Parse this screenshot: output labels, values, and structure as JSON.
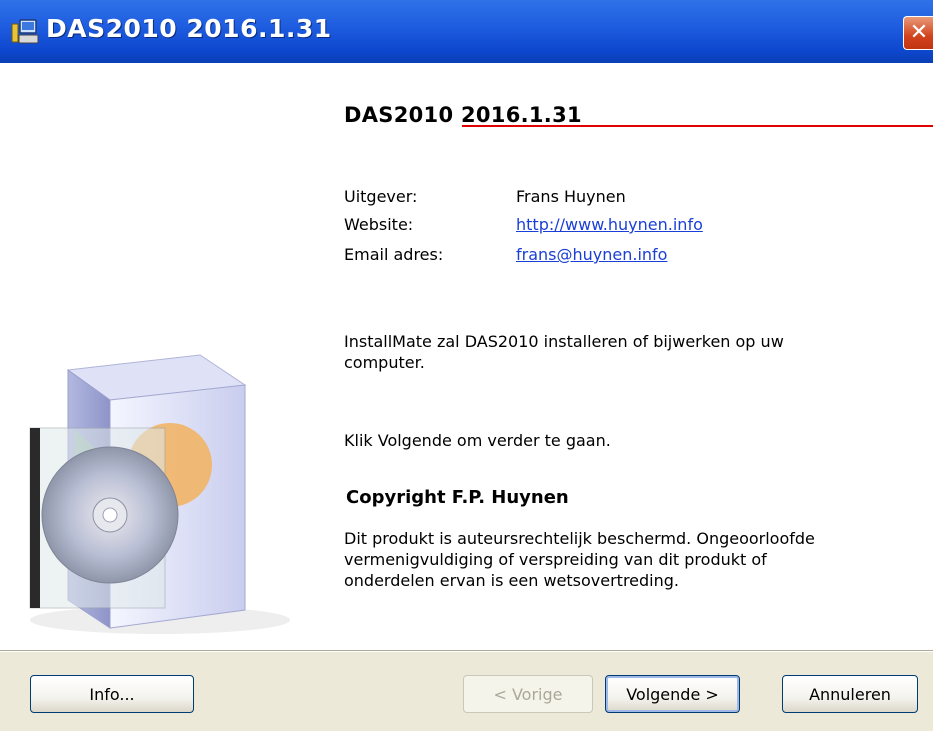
{
  "window": {
    "title": "DAS2010 2016.1.31",
    "close_icon": "close-icon"
  },
  "main": {
    "product_title": "DAS2010 2016.1.31",
    "details": [
      {
        "label": "Uitgever:",
        "value": "Frans Huynen",
        "is_link": false
      },
      {
        "label": "Website:",
        "value": "http://www.huynen.info",
        "is_link": true
      },
      {
        "label": "Email adres:",
        "value": "frans@huynen.info",
        "is_link": true
      }
    ],
    "intro_line1": "InstallMate zal DAS2010 installeren of bijwerken op uw",
    "intro_line2": "computer.",
    "next_hint": "Klik Volgende om verder te gaan.",
    "copyright_title": "Copyright F.P. Huynen",
    "copyright_line1": "Dit produkt is auteursrechtelijk beschermd. Ongeoorloofde",
    "copyright_line2": "vermenigvuldiging of verspreiding van dit produkt of",
    "copyright_line3": "onderdelen ervan is een wetsovertreding."
  },
  "buttons": {
    "info": "Info...",
    "back": "< Vorige",
    "next": "Volgende >",
    "cancel": "Annuleren"
  },
  "colors": {
    "titlebar": "#0a47cf",
    "annotation_line": "#e00000",
    "link": "#1a3fd6"
  }
}
